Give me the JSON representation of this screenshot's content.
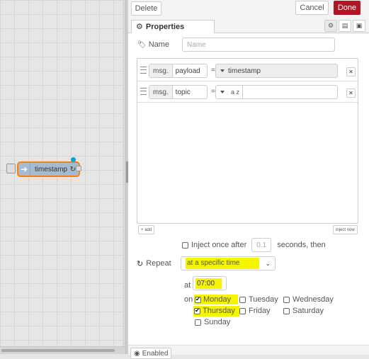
{
  "workspace": {
    "node": {
      "label": "timestamp",
      "refresh_glyph": "↻"
    }
  },
  "tray": {
    "delete_label": "Delete",
    "cancel_label": "Cancel",
    "done_label": "Done",
    "tab_properties": "Properties",
    "name_label": "Name",
    "name_placeholder": "Name",
    "props": [
      {
        "prefix": "msg.",
        "key": "payload",
        "eq": "=",
        "value": "timestamp"
      },
      {
        "prefix": "msg.",
        "key": "topic",
        "eq": "=",
        "value": ""
      }
    ],
    "az_text": "a z",
    "add_label": "add",
    "inject_now_label": "inject now",
    "inject_once_label": "Inject once after",
    "inject_once_value": "0.1",
    "seconds_label": "seconds, then",
    "repeat_label": "Repeat",
    "repeat_value": "at a specific time",
    "at_label": "at",
    "time_value": "07:00",
    "on_label": "on",
    "days": [
      {
        "name": "Monday",
        "checked": true
      },
      {
        "name": "Tuesday",
        "checked": false
      },
      {
        "name": "Wednesday",
        "checked": false
      },
      {
        "name": "Thursday",
        "checked": true
      },
      {
        "name": "Friday",
        "checked": false
      },
      {
        "name": "Saturday",
        "checked": false
      },
      {
        "name": "Sunday",
        "checked": false
      }
    ],
    "enabled_label": "Enabled"
  },
  "colors": {
    "accent": "#ad1625",
    "node": "#a6bbcf",
    "node_border": "#ff7f0e",
    "highlight": "#f5f500",
    "changed_dot": "#00a2e8"
  }
}
